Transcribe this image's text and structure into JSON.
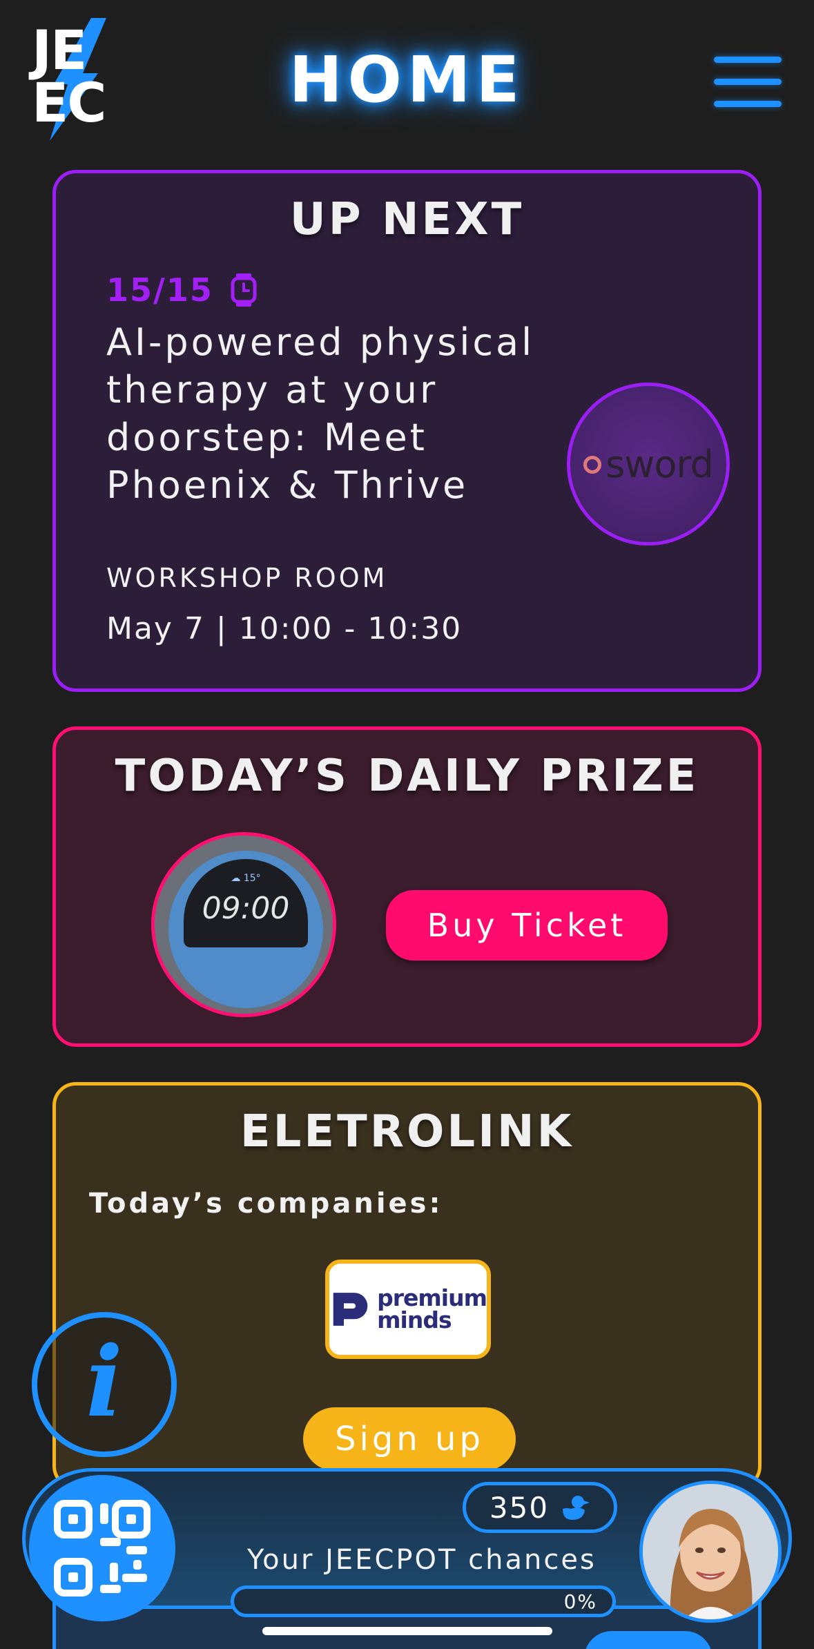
{
  "header": {
    "logo_text": "JE\nEC",
    "title": "HOME",
    "menu_icon": "hamburger-icon"
  },
  "up_next": {
    "title": "UP NEXT",
    "time_label": "15/15",
    "time_icon": "watch-icon",
    "talk_title": "AI-powered physical therapy at your doorstep: Meet Phoenix & Thrive",
    "room": "WORKSHOP ROOM",
    "date": "May 7 | 10:00 - 10:30",
    "speaker_logo_text": "sword",
    "accent": "#9b1ff5"
  },
  "daily_prize": {
    "title": "TODAY’S DAILY PRIZE",
    "prize_clock": "09:00",
    "prize_temp": "☁ 15°",
    "buy_label": "Buy Ticket",
    "accent": "#ff0f72"
  },
  "eletrolink": {
    "title": "ELETROLINK",
    "companies_label": "Today’s companies:",
    "company_name_line1": "premium",
    "company_name_line2": "minds",
    "signup_label": "Sign up",
    "accent": "#f7b418"
  },
  "info_button": {
    "icon": "info-icon",
    "glyph": "i"
  },
  "bottom_bar": {
    "qr_icon": "qr-code-icon",
    "points": "350",
    "points_icon": "duck-icon",
    "jeecpot_label": "Your JEECPOT chances",
    "progress_percent": 0,
    "progress_label": "0%",
    "accent": "#1e90ff"
  }
}
